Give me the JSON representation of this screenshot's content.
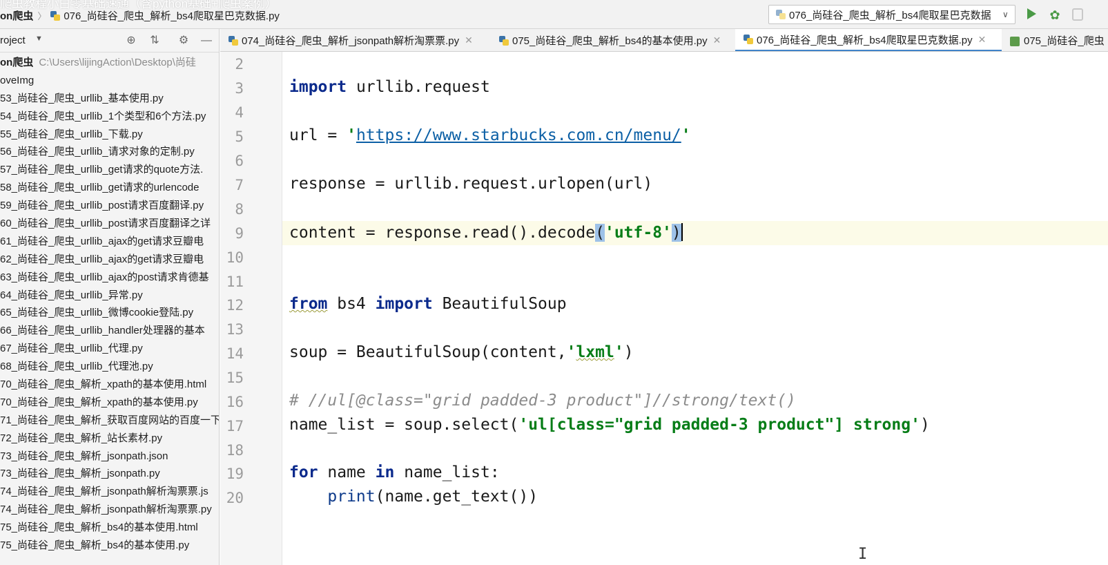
{
  "video_title": "爬虫教程小白零基础速通（含python基础+爬虫案例）",
  "breadcrumb": {
    "project": "on爬虫",
    "file": "076_尚硅谷_爬虫_解析_bs4爬取星巴克数据.py"
  },
  "run_config": {
    "label": "076_尚硅谷_爬虫_解析_bs4爬取星巴克数据"
  },
  "project_panel": {
    "title": "roject",
    "root_label": "on爬虫",
    "root_path": "C:\\Users\\lijingAction\\Desktop\\尚硅",
    "items": [
      "oveImg",
      "53_尚硅谷_爬虫_urllib_基本使用.py",
      "54_尚硅谷_爬虫_urllib_1个类型和6个方法.py",
      "55_尚硅谷_爬虫_urllib_下载.py",
      "56_尚硅谷_爬虫_urllib_请求对象的定制.py",
      "57_尚硅谷_爬虫_urllib_get请求的quote方法.",
      "58_尚硅谷_爬虫_urllib_get请求的urlencode",
      "59_尚硅谷_爬虫_urllib_post请求百度翻译.py",
      "60_尚硅谷_爬虫_urllib_post请求百度翻译之详",
      "61_尚硅谷_爬虫_urllib_ajax的get请求豆瓣电",
      "62_尚硅谷_爬虫_urllib_ajax的get请求豆瓣电",
      "63_尚硅谷_爬虫_urllib_ajax的post请求肯德基",
      "64_尚硅谷_爬虫_urllib_异常.py",
      "65_尚硅谷_爬虫_urllib_微博cookie登陆.py",
      "66_尚硅谷_爬虫_urllib_handler处理器的基本",
      "67_尚硅谷_爬虫_urllib_代理.py",
      "68_尚硅谷_爬虫_urllib_代理池.py",
      "70_尚硅谷_爬虫_解析_xpath的基本使用.html",
      "70_尚硅谷_爬虫_解析_xpath的基本使用.py",
      "71_尚硅谷_爬虫_解析_获取百度网站的百度一下",
      "72_尚硅谷_爬虫_解析_站长素材.py",
      "73_尚硅谷_爬虫_解析_jsonpath.json",
      "73_尚硅谷_爬虫_解析_jsonpath.py",
      "74_尚硅谷_爬虫_解析_jsonpath解析淘票票.js",
      "74_尚硅谷_爬虫_解析_jsonpath解析淘票票.py",
      "75_尚硅谷_爬虫_解析_bs4的基本使用.html",
      "75_尚硅谷_爬虫_解析_bs4的基本使用.py"
    ]
  },
  "tabs": [
    {
      "label": "074_尚硅谷_爬虫_解析_jsonpath解析淘票票.py",
      "active": false
    },
    {
      "label": "075_尚硅谷_爬虫_解析_bs4的基本使用.py",
      "active": false
    },
    {
      "label": "076_尚硅谷_爬虫_解析_bs4爬取星巴克数据.py",
      "active": true
    },
    {
      "label": "075_尚硅谷_爬虫",
      "active": false
    }
  ],
  "editor": {
    "line_numbers": [
      "2",
      "3",
      "4",
      "5",
      "6",
      "7",
      "8",
      "9",
      "10",
      "11",
      "12",
      "13",
      "14",
      "15",
      "16",
      "17",
      "18",
      "19",
      "20"
    ],
    "code": {
      "l3_kw": "import",
      "l3_rest": " urllib.request",
      "l5_pre": "url = ",
      "l5_q1": "'",
      "l5_url": "https://www.starbucks.com.cn/menu/",
      "l5_q2": "'",
      "l7": "response = urllib.request.urlopen(url)",
      "l9_pre": "content = response.read().decode",
      "l9_open": "(",
      "l9_str": "'utf-8'",
      "l9_close": ")",
      "l12_kw1": "from",
      "l12_mid": " bs4 ",
      "l12_kw2": "import",
      "l12_rest": " BeautifulSoup",
      "l14_pre": "soup = BeautifulSoup(content,",
      "l14_q1": "'",
      "l14_str": "lxml",
      "l14_q2": "'",
      "l14_post": ")",
      "l16": "# //ul[@class=\"grid padded-3 product\"]//strong/text()",
      "l17_pre": "name_list = soup.select(",
      "l17_str": "'ul[class=\"grid padded-3 product\"] strong'",
      "l17_post": ")",
      "l19_kw1": "for",
      "l19_mid": " name ",
      "l19_kw2": "in",
      "l19_rest": " name_list:",
      "l20_indent": "    ",
      "l20_fn": "print",
      "l20_rest": "(name.get_text())"
    }
  }
}
